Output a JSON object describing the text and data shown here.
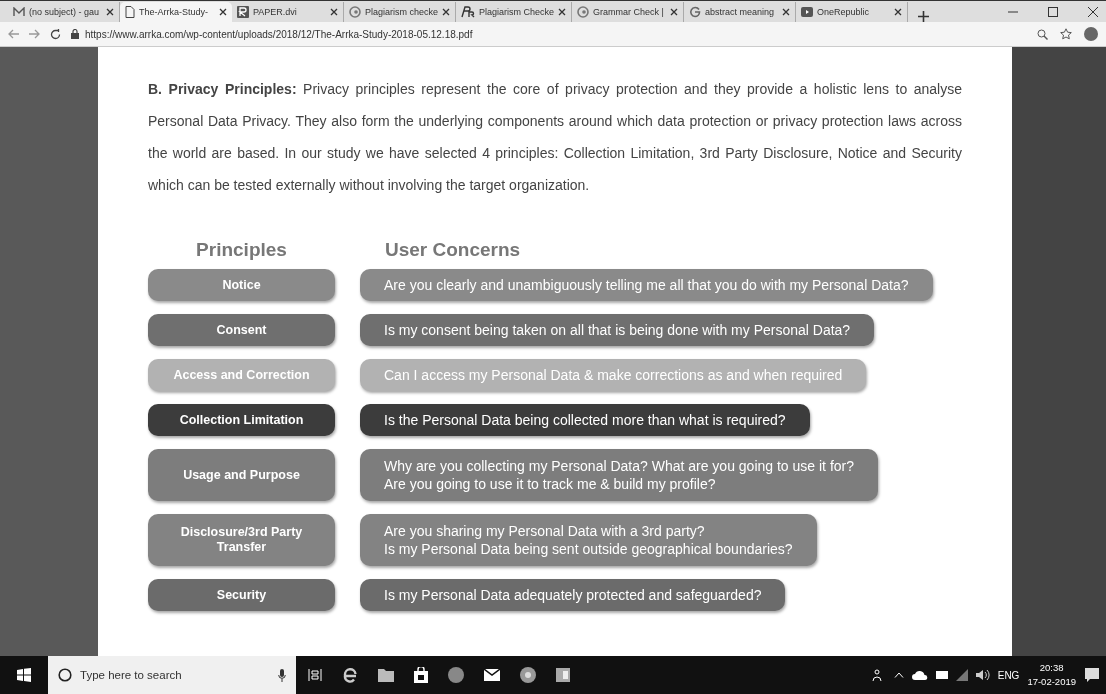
{
  "browser": {
    "tabs": [
      {
        "title": "(no subject) - gau",
        "kind": "mail",
        "selected": false
      },
      {
        "title": "The-Arrka-Study-",
        "kind": "doc",
        "selected": true
      },
      {
        "title": "PAPER.dvi",
        "kind": "r",
        "selected": false
      },
      {
        "title": "Plagiarism checke",
        "kind": "c",
        "selected": false
      },
      {
        "title": "Plagiarism Checke",
        "kind": "pr",
        "selected": false
      },
      {
        "title": "Grammar Check |",
        "kind": "c",
        "selected": false
      },
      {
        "title": "abstract meaning",
        "kind": "g",
        "selected": false
      },
      {
        "title": "OneRepublic",
        "kind": "video",
        "selected": false
      }
    ],
    "url": "https://www.arrka.com/wp-content/uploads/2018/12/The-Arrka-Study-2018-05.12.18.pdf"
  },
  "document": {
    "paragraph": "**B. Privacy Principles:** Privacy principles represent the core of privacy protection and they provide a holistic lens to analyse Personal Data Privacy. They also form the underlying components around which data protection or privacy protection laws across the world are based. In our study we have selected 4 principles: Collection Limitation, 3rd Party Disclosure, Notice and Security which can be tested externally without involving the target organization.",
    "headings": [
      "Principles",
      "User Concerns"
    ],
    "rows": [
      {
        "principle": "Notice",
        "concern": "Are you clearly and unambiguously telling me all that you do with my Personal Data?",
        "color": "#8a8a8a"
      },
      {
        "principle": "Consent",
        "concern": "Is my consent being taken on all that is being done with my Personal Data?",
        "color": "#6f6f6f"
      },
      {
        "principle": "Access and Correction",
        "concern": "Can I access my Personal Data & make corrections as and when required",
        "color": "#b2b2b2"
      },
      {
        "principle": "Collection Limitation",
        "concern": "Is the Personal Data being collected more than what is required?",
        "color": "#3c3c3c"
      },
      {
        "principle": "Usage and Purpose",
        "concern": "Why are you collecting my Personal Data? What are you going to use it for?\nAre you going to use it to track me & build my profile?",
        "color": "#7d7d7d"
      },
      {
        "principle": "Disclosure/3rd Party Transfer",
        "concern": "Are you sharing my Personal Data with a 3rd party?\nIs my Personal Data being sent outside geographical boundaries?",
        "color": "#838383"
      },
      {
        "principle": "Security",
        "concern": "Is my Personal Data adequately protected and safeguarded?",
        "color": "#6b6b6b"
      }
    ]
  },
  "taskbar": {
    "search_placeholder": "Type here to search",
    "language": "ENG",
    "time": "20:38",
    "date": "17-02-2019"
  }
}
